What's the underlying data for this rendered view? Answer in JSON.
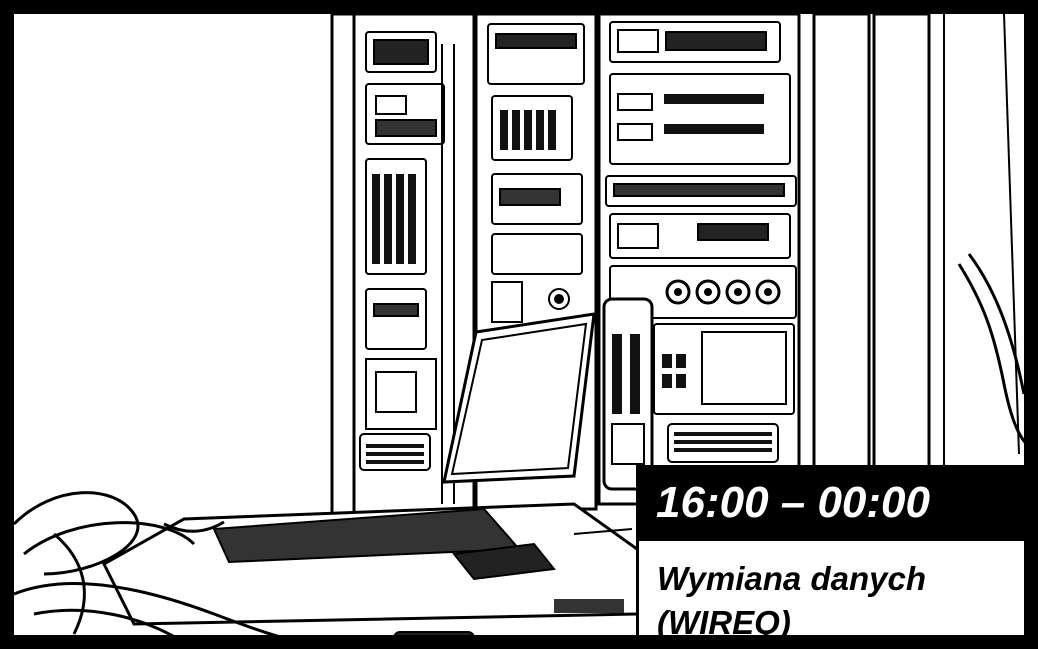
{
  "event": {
    "time": "16:00 – 00:00",
    "title": "Wymiana danych (WIREQ)"
  },
  "illustration": {
    "subject": "server-racks-and-laptop",
    "style": "line-art",
    "colors": {
      "ink": "#000000",
      "paper": "#ffffff"
    }
  }
}
